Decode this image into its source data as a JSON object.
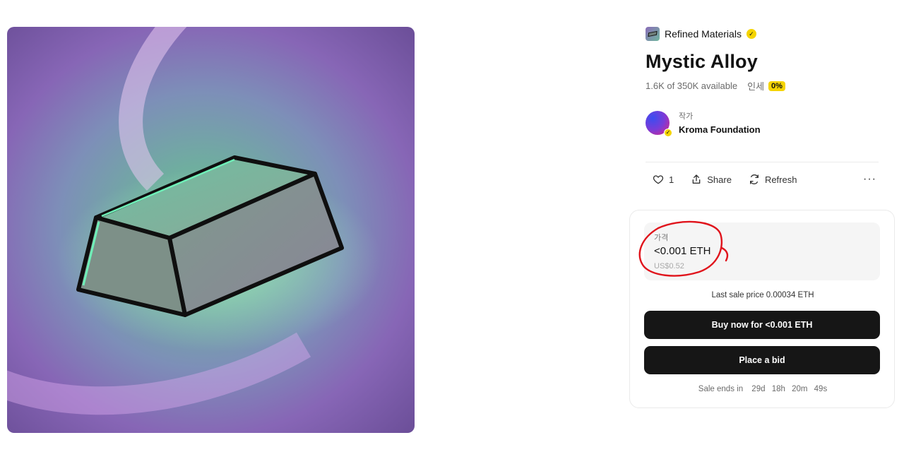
{
  "artwork": {
    "alt_icon": "metal-ingot-artwork"
  },
  "collection": {
    "name": "Refined Materials",
    "verified_icon": "verified-check-icon"
  },
  "item": {
    "title": "Mystic Alloy",
    "availability": "1.6K of 350K available",
    "edition_label": "인세",
    "fee_badge": "0%"
  },
  "creator": {
    "role": "작가",
    "name": "Kroma Foundation"
  },
  "actions": {
    "like_count": "1",
    "share_label": "Share",
    "refresh_label": "Refresh",
    "more_label": "···"
  },
  "price": {
    "label": "가격",
    "value": "<0.001 ETH",
    "usd": "US$0.52"
  },
  "last_sale": "Last sale price 0.00034 ETH",
  "buttons": {
    "buy": "Buy now for <0.001 ETH",
    "bid": "Place a bid"
  },
  "sale_ends": {
    "label": "Sale ends in",
    "days": "29d",
    "hours": "18h",
    "minutes": "20m",
    "seconds": "49s"
  },
  "colors": {
    "accent_yellow": "#f5d400",
    "button_bg": "#161616",
    "annotation_red": "#e0141c"
  }
}
